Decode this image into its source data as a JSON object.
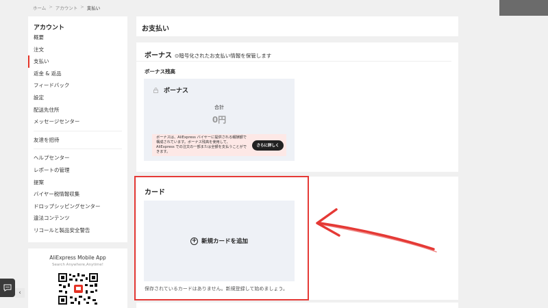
{
  "breadcrumb": [
    "ホーム",
    "アカウント",
    "支払い"
  ],
  "sidebar": {
    "title": "アカウント",
    "groups": [
      [
        "概要",
        "注文",
        "支払い",
        "返金 & 返品",
        "フィードバック",
        "設定",
        "配送先住所",
        "メッセージセンター"
      ],
      [
        "友達を招待"
      ],
      [
        "ヘルプセンター",
        "レポートの管理",
        "提案",
        "バイヤー税情報収集",
        "ドロップシッピングセンター",
        "違法コンテンツ",
        "リコールと製品安全警告"
      ]
    ],
    "active": "支払い"
  },
  "app": {
    "title": "AliExpress Mobile App",
    "subtitle": "Search Anywhere,Anytime!"
  },
  "page": {
    "title": "お支払い"
  },
  "bonus": {
    "heading": "ボーナス",
    "note": "⊙暗号化されたお支払い情報を保管します",
    "balance_label": "ボーナス残高",
    "card_label": "ボーナス",
    "total_label": "合計",
    "amount": "0円",
    "promo_text": "ボーナスは、AliExpress バイヤーに提供される報酬額で構成されています。ボーナス残高を使用して、AliExpress での注文の一部または全額を支払うことができます。",
    "promo_button": "さらに詳しく"
  },
  "card": {
    "heading": "カード",
    "add_label": "新規カードを追加",
    "empty_text": "保存されているカードはありません。新規登録して始めましょう。"
  },
  "colors": {
    "accent": "#e43225",
    "highlight": "#e53935",
    "panel_bg": "#eef1f6",
    "promo_bg": "#fde8e6"
  }
}
